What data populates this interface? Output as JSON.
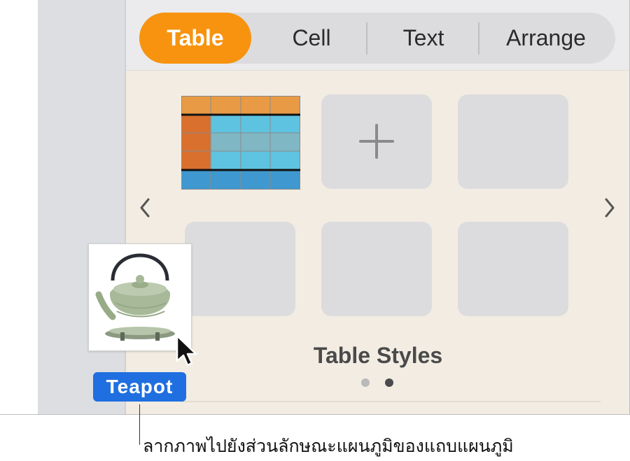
{
  "tabs": [
    {
      "label": "Table",
      "active": true
    },
    {
      "label": "Cell",
      "active": false
    },
    {
      "label": "Text",
      "active": false
    },
    {
      "label": "Arrange",
      "active": false
    }
  ],
  "panel": {
    "section_title": "Table Styles",
    "page_count": 2,
    "current_page": 2
  },
  "drag": {
    "label": "Teapot",
    "image_icon": "teapot-image"
  },
  "callout": {
    "text": "ลากภาพไปยังส่วนลักษณะแผนภูมิของแถบแผนภูมิ"
  },
  "colors": {
    "active_tab": "#f7930f",
    "drag_label": "#1f6fe0",
    "table_header": "#e89a45",
    "table_side": "#d9702e",
    "table_body_a": "#5ec3e0",
    "table_body_b": "#7fb8c4",
    "table_footer": "#3f98cf",
    "teapot": "#a7b998"
  }
}
